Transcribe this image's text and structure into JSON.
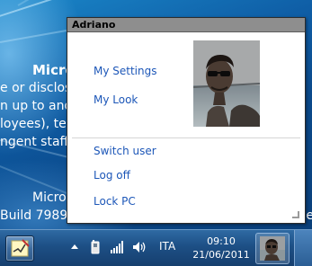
{
  "wallpaper": {
    "title": "Microso",
    "lines": [
      "e or disclos",
      "n up to and",
      "loyees), terr",
      "ngent staff)"
    ],
    "bottom_lines": [
      "Microso",
      "Build 7989.winmain.110421-1825:01597 fe7557ef5974"
    ]
  },
  "popup": {
    "user_name": "Adriano",
    "menu": {
      "my_settings": "My Settings",
      "my_look": "My Look",
      "switch_user": "Switch user",
      "log_off": "Log off",
      "lock_pc": "Lock PC"
    }
  },
  "taskbar": {
    "language": "ITA",
    "time": "09:10",
    "date": "21/06/2011",
    "tray_icons": [
      "chevron-up-icon",
      "phone-device-icon",
      "signal-bars-icon",
      "speaker-icon"
    ]
  },
  "colors": {
    "link": "#1d57b8",
    "header_bg": "#8e8e8e",
    "taskbar_top": "#2f6aa3",
    "taskbar_bottom": "#163f6e"
  }
}
